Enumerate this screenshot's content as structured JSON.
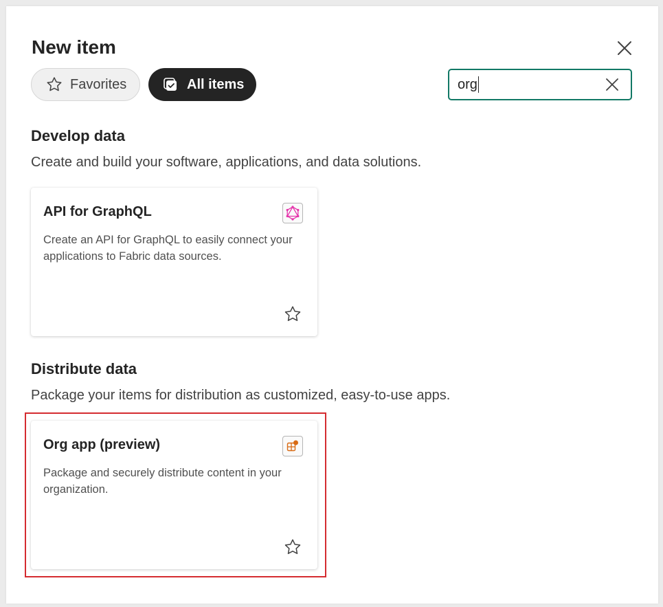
{
  "dialog": {
    "title": "New item"
  },
  "filters": {
    "favorites_label": "Favorites",
    "all_items_label": "All items",
    "active": "All items"
  },
  "search": {
    "value": "org"
  },
  "sections": [
    {
      "title": "Develop data",
      "description": "Create and build your software, applications, and data solutions.",
      "cards": [
        {
          "title": "API for GraphQL",
          "description": "Create an API for GraphQL to easily connect your applications to Fabric data sources.",
          "icon": "graphql-icon",
          "icon_color": "#e535ab"
        }
      ]
    },
    {
      "title": "Distribute data",
      "description": "Package your items for distribution as customized, easy-to-use apps.",
      "cards": [
        {
          "title": "Org app (preview)",
          "description": "Package and securely distribute content in your organization.",
          "icon": "org-app-icon",
          "icon_color": "#d86b14"
        }
      ]
    }
  ],
  "colors": {
    "search_border": "#117865",
    "highlight": "#d42b2f",
    "active_pill": "#242424"
  }
}
